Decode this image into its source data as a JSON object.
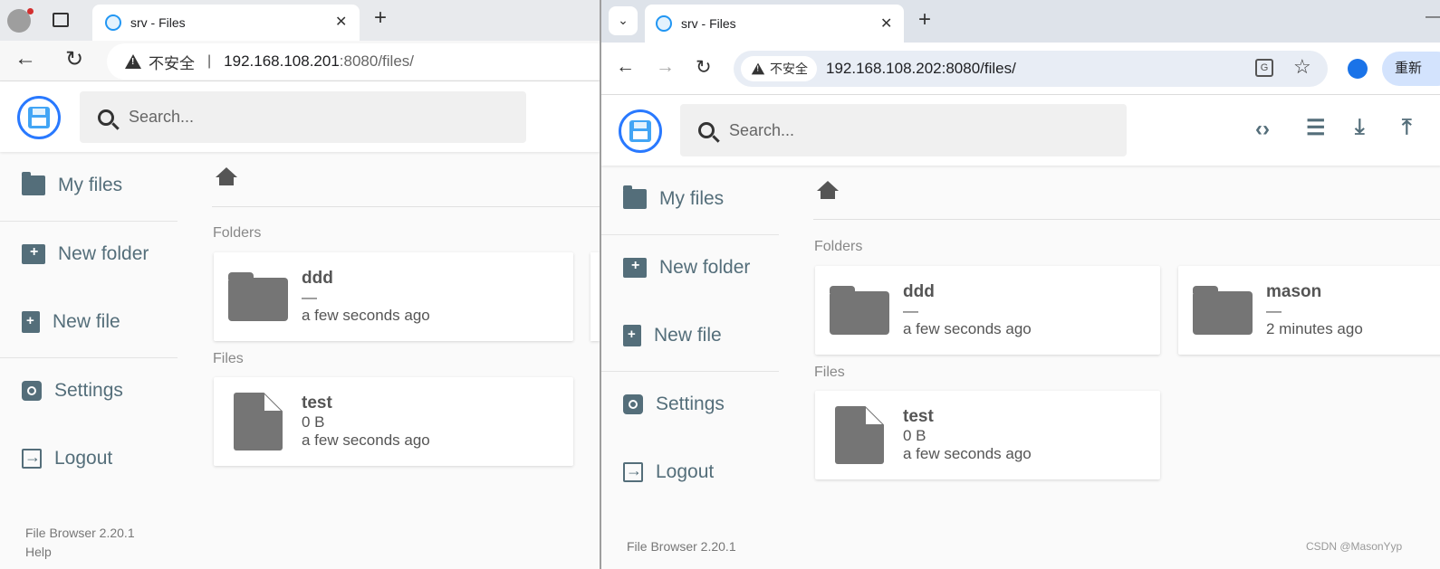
{
  "left": {
    "tab_title": "srv - Files",
    "insecure_label": "不安全",
    "url_host": "192.168.108.201",
    "url_rest": ":8080/files/",
    "search_placeholder": "Search...",
    "sidebar": [
      "My files",
      "New folder",
      "New file",
      "Settings",
      "Logout"
    ],
    "folders_label": "Folders",
    "files_label": "Files",
    "folders": [
      {
        "name": "ddd",
        "size": "—",
        "modified": "a few seconds ago"
      }
    ],
    "files": [
      {
        "name": "test",
        "size": "0 B",
        "modified": "a few seconds ago"
      }
    ],
    "footer": {
      "version": "File Browser 2.20.1",
      "help": "Help"
    }
  },
  "right": {
    "tab_title": "srv - Files",
    "insecure_label": "不安全",
    "url": "192.168.108.202:8080/files/",
    "relaunch_label": "重新",
    "search_placeholder": "Search...",
    "sidebar": [
      "My files",
      "New folder",
      "New file",
      "Settings",
      "Logout"
    ],
    "folders_label": "Folders",
    "files_label": "Files",
    "folders": [
      {
        "name": "ddd",
        "size": "—",
        "modified": "a few seconds ago"
      },
      {
        "name": "mason",
        "size": "—",
        "modified": "2 minutes ago"
      }
    ],
    "files": [
      {
        "name": "test",
        "size": "0 B",
        "modified": "a few seconds ago"
      }
    ],
    "footer": {
      "version": "File Browser 2.20.1"
    },
    "watermark": "CSDN @MasonYyp"
  },
  "icons": {
    "toolbar": [
      "code-icon",
      "list-view-icon",
      "download-icon",
      "upload-icon"
    ],
    "accent": "#2979ff",
    "sidebar_color": "#546e7a"
  }
}
